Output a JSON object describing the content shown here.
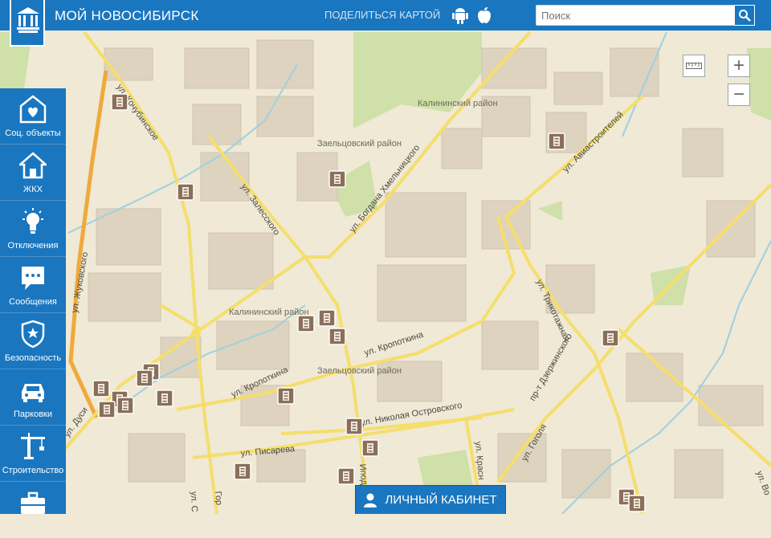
{
  "header": {
    "title": "МОЙ НОВОСИБИРСК",
    "share_label": "ПОДЕЛИТЬСЯ КАРТОЙ",
    "search_placeholder": "Поиск",
    "accent": "#1a76bf"
  },
  "sidebar": {
    "items": [
      {
        "label": "Соц. объекты",
        "icon": "social-objects-icon"
      },
      {
        "label": "ЖКХ",
        "icon": "house-icon"
      },
      {
        "label": "Отключения",
        "icon": "lightbulb-icon"
      },
      {
        "label": "Сообщения",
        "icon": "message-icon"
      },
      {
        "label": "Безопасность",
        "icon": "shield-icon"
      },
      {
        "label": "Парковки",
        "icon": "car-icon"
      },
      {
        "label": "Строительство",
        "icon": "crane-icon"
      },
      {
        "label": "",
        "icon": "briefcase-icon"
      }
    ]
  },
  "map": {
    "district_labels": [
      "Калининский район",
      "Заельцовский район",
      "Калининский район",
      "Заельцовский район"
    ],
    "street_labels": [
      "ул. Кочубинское",
      "ул. Жуковского",
      "ул. Богдана Хмельницкого",
      "ул. Залесского",
      "ул. Авиастроителей",
      "ул. Трикотажная",
      "пр-т Дзержинского",
      "ул. Кропоткина",
      "ул. Кропоткина",
      "ул. Дуси",
      "ул. Николая Островского",
      "ул. Писарева",
      "ул. Гоголя",
      "ул. Красн",
      "ул. Во",
      "Гор",
      "ул. С",
      "Ипод"
    ],
    "zoom_in": "+",
    "zoom_out": "−"
  },
  "cabinet_label": "ЛИЧНЫЙ КАБИНЕТ"
}
